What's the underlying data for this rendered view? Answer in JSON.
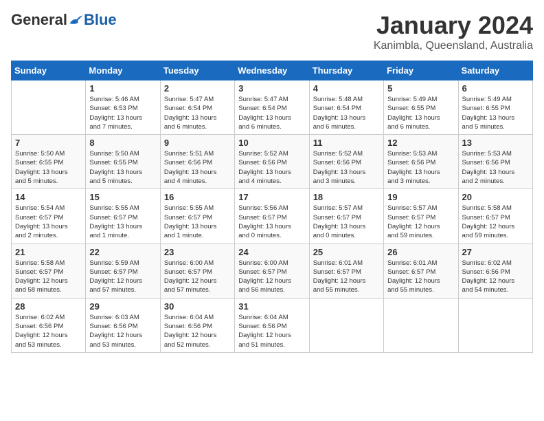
{
  "logo": {
    "general": "General",
    "blue": "Blue"
  },
  "title": "January 2024",
  "location": "Kanimbla, Queensland, Australia",
  "weekdays": [
    "Sunday",
    "Monday",
    "Tuesday",
    "Wednesday",
    "Thursday",
    "Friday",
    "Saturday"
  ],
  "weeks": [
    [
      {
        "day": "",
        "info": ""
      },
      {
        "day": "1",
        "info": "Sunrise: 5:46 AM\nSunset: 6:53 PM\nDaylight: 13 hours\nand 7 minutes."
      },
      {
        "day": "2",
        "info": "Sunrise: 5:47 AM\nSunset: 6:54 PM\nDaylight: 13 hours\nand 6 minutes."
      },
      {
        "day": "3",
        "info": "Sunrise: 5:47 AM\nSunset: 6:54 PM\nDaylight: 13 hours\nand 6 minutes."
      },
      {
        "day": "4",
        "info": "Sunrise: 5:48 AM\nSunset: 6:54 PM\nDaylight: 13 hours\nand 6 minutes."
      },
      {
        "day": "5",
        "info": "Sunrise: 5:49 AM\nSunset: 6:55 PM\nDaylight: 13 hours\nand 6 minutes."
      },
      {
        "day": "6",
        "info": "Sunrise: 5:49 AM\nSunset: 6:55 PM\nDaylight: 13 hours\nand 5 minutes."
      }
    ],
    [
      {
        "day": "7",
        "info": "Sunrise: 5:50 AM\nSunset: 6:55 PM\nDaylight: 13 hours\nand 5 minutes."
      },
      {
        "day": "8",
        "info": "Sunrise: 5:50 AM\nSunset: 6:55 PM\nDaylight: 13 hours\nand 5 minutes."
      },
      {
        "day": "9",
        "info": "Sunrise: 5:51 AM\nSunset: 6:56 PM\nDaylight: 13 hours\nand 4 minutes."
      },
      {
        "day": "10",
        "info": "Sunrise: 5:52 AM\nSunset: 6:56 PM\nDaylight: 13 hours\nand 4 minutes."
      },
      {
        "day": "11",
        "info": "Sunrise: 5:52 AM\nSunset: 6:56 PM\nDaylight: 13 hours\nand 3 minutes."
      },
      {
        "day": "12",
        "info": "Sunrise: 5:53 AM\nSunset: 6:56 PM\nDaylight: 13 hours\nand 3 minutes."
      },
      {
        "day": "13",
        "info": "Sunrise: 5:53 AM\nSunset: 6:56 PM\nDaylight: 13 hours\nand 2 minutes."
      }
    ],
    [
      {
        "day": "14",
        "info": "Sunrise: 5:54 AM\nSunset: 6:57 PM\nDaylight: 13 hours\nand 2 minutes."
      },
      {
        "day": "15",
        "info": "Sunrise: 5:55 AM\nSunset: 6:57 PM\nDaylight: 13 hours\nand 1 minute."
      },
      {
        "day": "16",
        "info": "Sunrise: 5:55 AM\nSunset: 6:57 PM\nDaylight: 13 hours\nand 1 minute."
      },
      {
        "day": "17",
        "info": "Sunrise: 5:56 AM\nSunset: 6:57 PM\nDaylight: 13 hours\nand 0 minutes."
      },
      {
        "day": "18",
        "info": "Sunrise: 5:57 AM\nSunset: 6:57 PM\nDaylight: 13 hours\nand 0 minutes."
      },
      {
        "day": "19",
        "info": "Sunrise: 5:57 AM\nSunset: 6:57 PM\nDaylight: 12 hours\nand 59 minutes."
      },
      {
        "day": "20",
        "info": "Sunrise: 5:58 AM\nSunset: 6:57 PM\nDaylight: 12 hours\nand 59 minutes."
      }
    ],
    [
      {
        "day": "21",
        "info": "Sunrise: 5:58 AM\nSunset: 6:57 PM\nDaylight: 12 hours\nand 58 minutes."
      },
      {
        "day": "22",
        "info": "Sunrise: 5:59 AM\nSunset: 6:57 PM\nDaylight: 12 hours\nand 57 minutes."
      },
      {
        "day": "23",
        "info": "Sunrise: 6:00 AM\nSunset: 6:57 PM\nDaylight: 12 hours\nand 57 minutes."
      },
      {
        "day": "24",
        "info": "Sunrise: 6:00 AM\nSunset: 6:57 PM\nDaylight: 12 hours\nand 56 minutes."
      },
      {
        "day": "25",
        "info": "Sunrise: 6:01 AM\nSunset: 6:57 PM\nDaylight: 12 hours\nand 55 minutes."
      },
      {
        "day": "26",
        "info": "Sunrise: 6:01 AM\nSunset: 6:57 PM\nDaylight: 12 hours\nand 55 minutes."
      },
      {
        "day": "27",
        "info": "Sunrise: 6:02 AM\nSunset: 6:56 PM\nDaylight: 12 hours\nand 54 minutes."
      }
    ],
    [
      {
        "day": "28",
        "info": "Sunrise: 6:02 AM\nSunset: 6:56 PM\nDaylight: 12 hours\nand 53 minutes."
      },
      {
        "day": "29",
        "info": "Sunrise: 6:03 AM\nSunset: 6:56 PM\nDaylight: 12 hours\nand 53 minutes."
      },
      {
        "day": "30",
        "info": "Sunrise: 6:04 AM\nSunset: 6:56 PM\nDaylight: 12 hours\nand 52 minutes."
      },
      {
        "day": "31",
        "info": "Sunrise: 6:04 AM\nSunset: 6:56 PM\nDaylight: 12 hours\nand 51 minutes."
      },
      {
        "day": "",
        "info": ""
      },
      {
        "day": "",
        "info": ""
      },
      {
        "day": "",
        "info": ""
      }
    ]
  ]
}
